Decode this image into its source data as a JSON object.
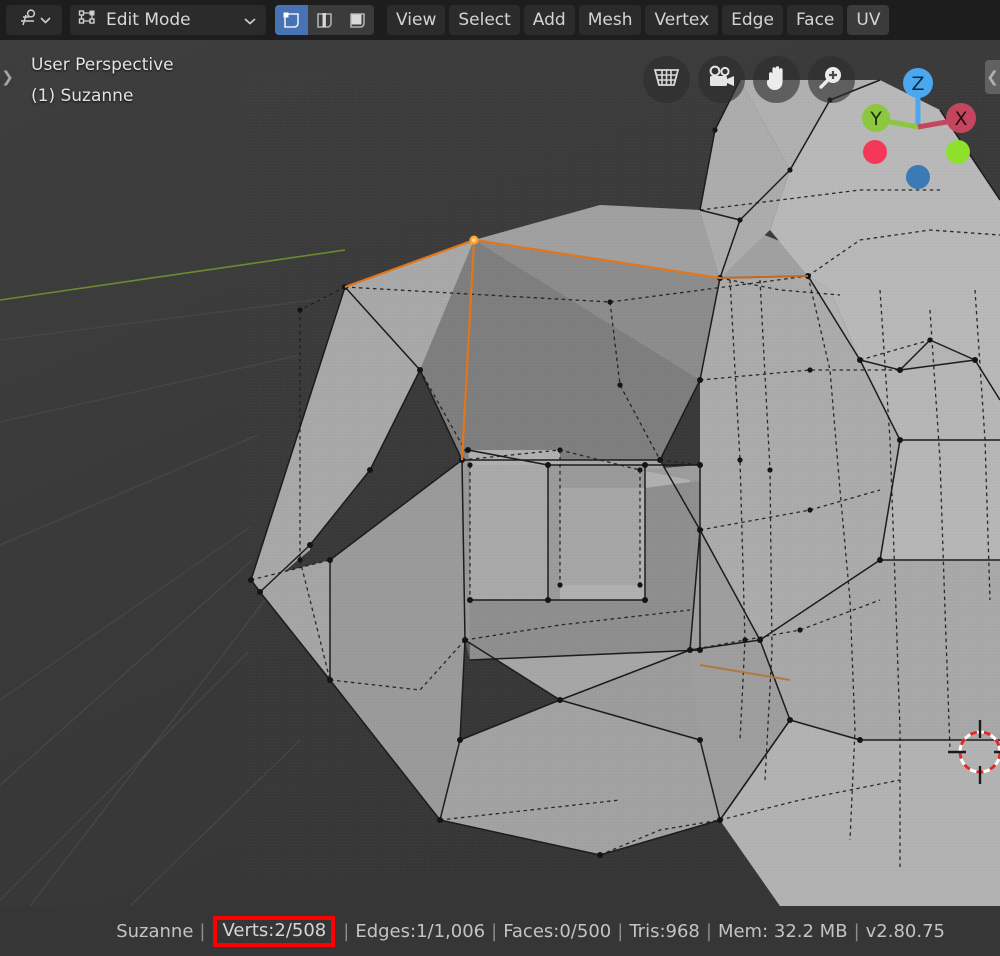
{
  "header": {
    "editor_type": {
      "name": "editor-type-selector",
      "icon": "3d-viewport-icon",
      "chevron": "⌄"
    },
    "mode": {
      "icon": "edit-mode-icon",
      "label": "Edit Mode",
      "chevron": "⌄"
    },
    "select_modes": [
      {
        "name": "vertex-select-mode",
        "icon": "vertex-icon",
        "active": true
      },
      {
        "name": "edge-select-mode",
        "icon": "edge-icon",
        "active": false
      },
      {
        "name": "face-select-mode",
        "icon": "face-icon",
        "active": false
      }
    ],
    "menus": [
      {
        "label": "View"
      },
      {
        "label": "Select"
      },
      {
        "label": "Add"
      },
      {
        "label": "Mesh"
      },
      {
        "label": "Vertex"
      },
      {
        "label": "Edge"
      },
      {
        "label": "Face"
      }
    ],
    "uv_label": "UV"
  },
  "viewport": {
    "perspective_label": "User Perspective",
    "object_label": "(1) Suzanne",
    "left_region_arrow": "❯",
    "right_region_arrow": "❮",
    "background_color": "#3c3c3c",
    "nav_buttons": [
      {
        "name": "toggle-perspective-ortho-button",
        "icon": "grid-perspective-icon"
      },
      {
        "name": "camera-view-button",
        "icon": "camera-icon"
      },
      {
        "name": "pan-view-button",
        "icon": "hand-icon"
      },
      {
        "name": "zoom-view-button",
        "icon": "magnifier-plus-icon"
      }
    ],
    "gizmo": {
      "axes": [
        {
          "label": "Z",
          "color": "#4aa8f0",
          "name": "gizmo-axis-z"
        },
        {
          "label": "Y",
          "color": "#8dc63f",
          "name": "gizmo-axis-y"
        },
        {
          "label": "X",
          "color": "#c4455e",
          "name": "gizmo-axis-x"
        },
        {
          "label": "",
          "color": "#f4385a",
          "name": "gizmo-axis-neg-x"
        },
        {
          "label": "",
          "color": "#8ee02a",
          "name": "gizmo-axis-neg-y"
        },
        {
          "label": "",
          "color": "#3a7ab5",
          "name": "gizmo-axis-neg-z"
        }
      ]
    },
    "cursor_3d": {
      "name": "3d-cursor",
      "color": "#e03030"
    },
    "selected_vertex_color": "#ff8c1a",
    "mesh_name": "Suzanne"
  },
  "status_bar": {
    "object_name": "Suzanne",
    "verts": "Verts:2/508",
    "edges": "Edges:1/1,006",
    "faces": "Faces:0/500",
    "tris": "Tris:968",
    "memory": "Mem: 32.2 MB",
    "version": "v2.80.75",
    "separator": "|",
    "highlight_color": "#ff0000"
  }
}
